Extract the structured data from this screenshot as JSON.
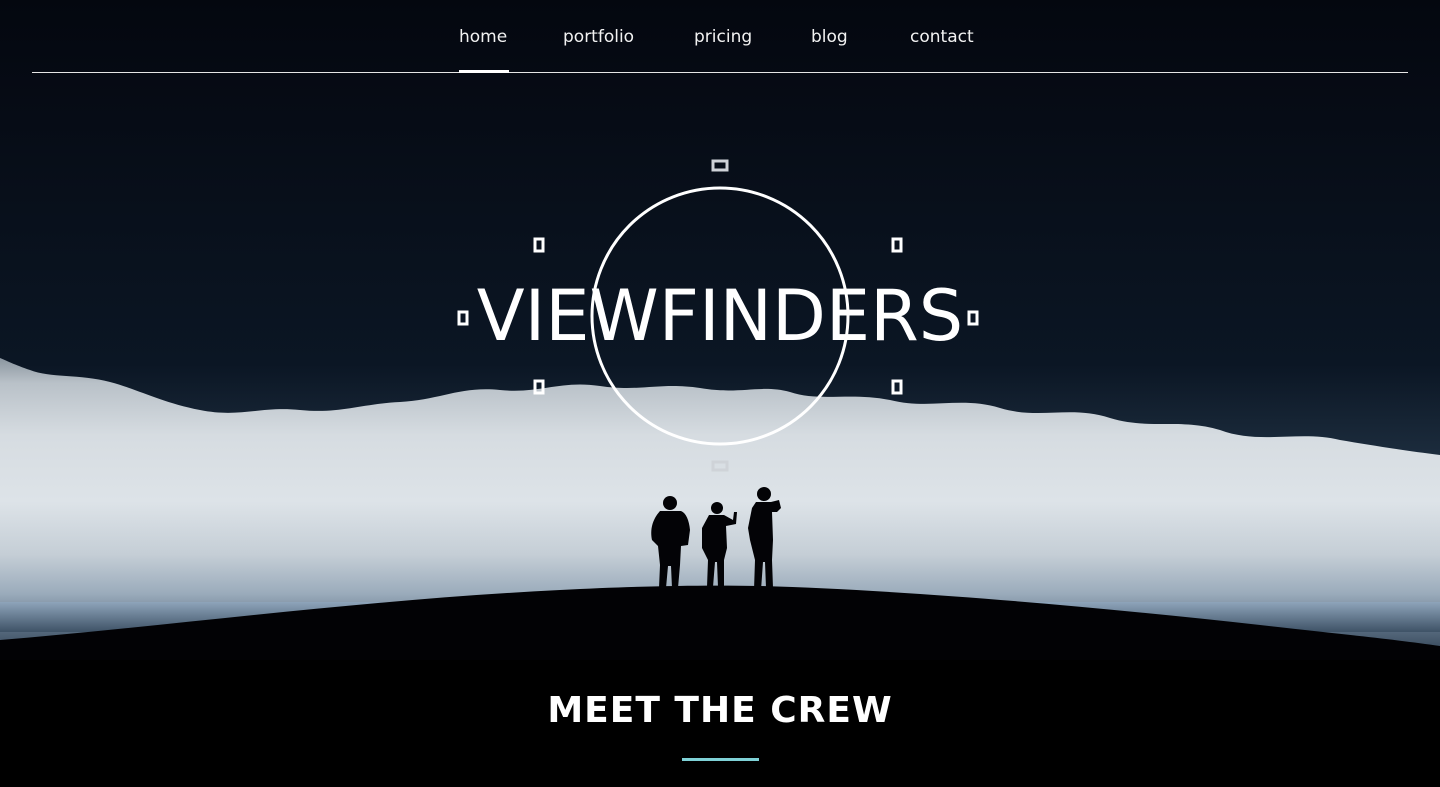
{
  "nav": {
    "items": [
      {
        "label": "home",
        "active": true
      },
      {
        "label": "portfolio",
        "active": false
      },
      {
        "label": "pricing",
        "active": false
      },
      {
        "label": "blog",
        "active": false
      },
      {
        "label": "contact",
        "active": false
      }
    ]
  },
  "hero": {
    "title": "VIEWFINDERS"
  },
  "crew": {
    "title": "MEET THE CREW"
  },
  "colors": {
    "accent": "#7fd1d6",
    "text": "#ffffff",
    "background": "#000000"
  }
}
